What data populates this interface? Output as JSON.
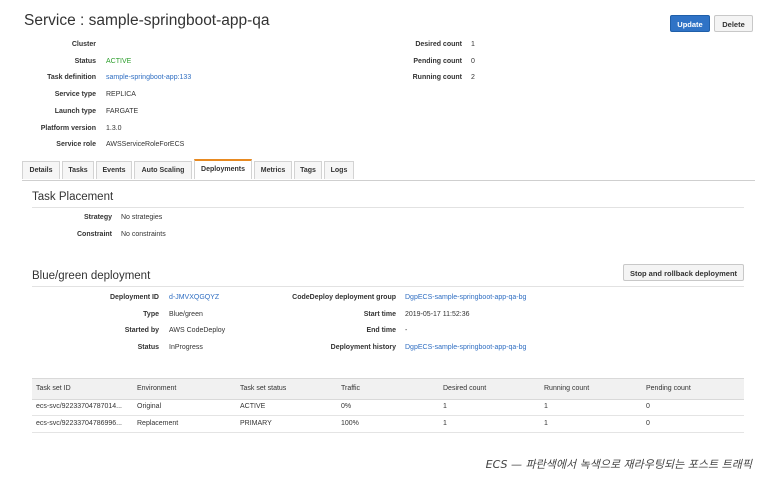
{
  "page_title": "Service : sample-springboot-app-qa",
  "buttons": {
    "update": "Update",
    "delete": "Delete",
    "stop_rollback": "Stop and rollback deployment"
  },
  "service_fields": [
    {
      "key": "Cluster",
      "value": ""
    },
    {
      "key": "Status",
      "value": "ACTIVE"
    },
    {
      "key": "Task definition",
      "value": "sample-springboot-app:133"
    },
    {
      "key": "Service type",
      "value": "REPLICA"
    },
    {
      "key": "Launch type",
      "value": "FARGATE"
    },
    {
      "key": "Platform version",
      "value": "1.3.0"
    },
    {
      "key": "Service role",
      "value": "AWSServiceRoleForECS"
    }
  ],
  "count_fields": [
    {
      "key": "Desired count",
      "value": "1"
    },
    {
      "key": "Pending count",
      "value": "0"
    },
    {
      "key": "Running count",
      "value": "2"
    }
  ],
  "tabs": [
    "Details",
    "Tasks",
    "Events",
    "Auto Scaling",
    "Deployments",
    "Metrics",
    "Tags",
    "Logs"
  ],
  "active_tab": "Deployments",
  "task_placement": {
    "title": "Task Placement",
    "strategy_label": "Strategy",
    "strategy_value": "No strategies",
    "constraint_label": "Constraint",
    "constraint_value": "No constraints"
  },
  "bluegreen": {
    "title": "Blue/green deployment",
    "left": [
      {
        "key": "Deployment ID",
        "value": "d-JMVXQGQYZ"
      },
      {
        "key": "Type",
        "value": "Blue/green"
      },
      {
        "key": "Started by",
        "value": "AWS CodeDeploy"
      },
      {
        "key": "Status",
        "value": "InProgress"
      }
    ],
    "right": [
      {
        "key": "CodeDeploy deployment group",
        "value": "DgpECS-sample-springboot-app-qa-bg"
      },
      {
        "key": "Start time",
        "value": "2019-05-17 11:52:36"
      },
      {
        "key": "End time",
        "value": "-"
      },
      {
        "key": "Deployment history",
        "value": "DgpECS-sample-springboot-app-qa-bg"
      }
    ]
  },
  "taskset_table": {
    "headers": [
      "Task set ID",
      "Environment",
      "Task set status",
      "Traffic",
      "Desired count",
      "Running count",
      "Pending count"
    ],
    "rows": [
      [
        "ecs-svc/92233704787014...",
        "Original",
        "ACTIVE",
        "0%",
        "1",
        "1",
        "0"
      ],
      [
        "ecs-svc/92233704786996...",
        "Replacement",
        "PRIMARY",
        "100%",
        "1",
        "1",
        "0"
      ]
    ]
  },
  "caption": "ECS — 파란색에서 녹색으로 재라우팅되는 포스트 트래픽",
  "colors": {
    "primary_button": "#2f73c6",
    "status_active": "#2c9e2c",
    "link": "#2f6ec2",
    "active_tab_accent": "#e88a21"
  }
}
